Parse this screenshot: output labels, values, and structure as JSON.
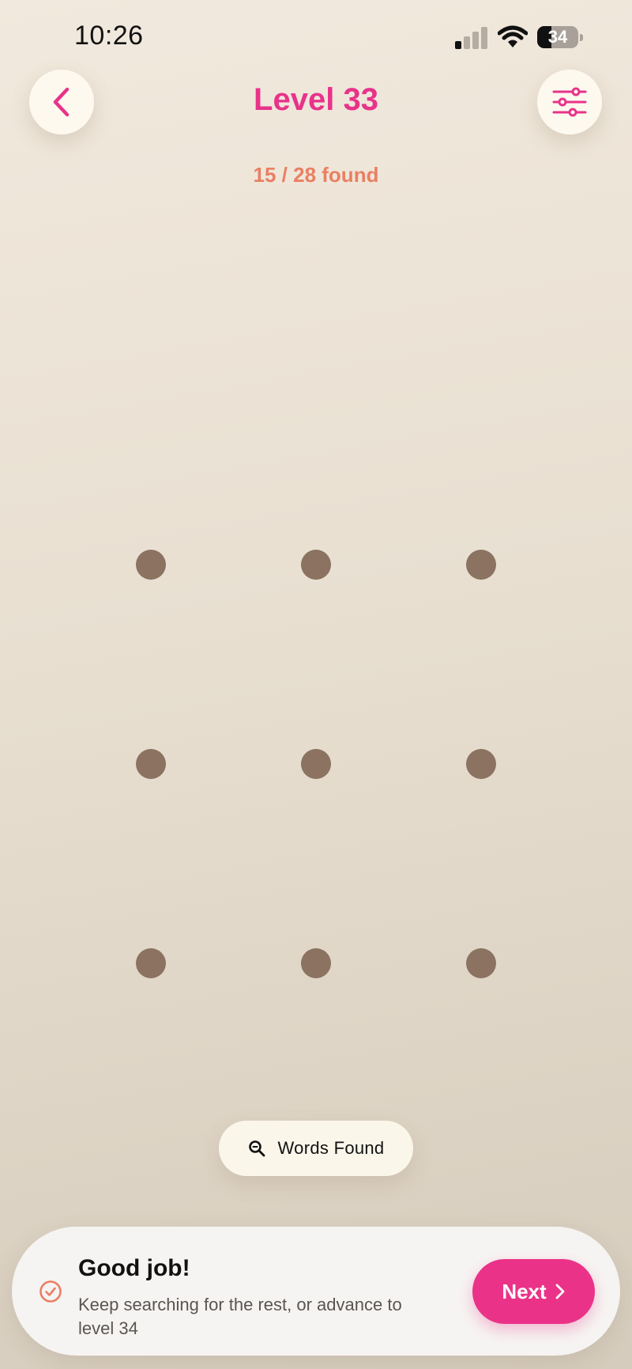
{
  "status_bar": {
    "time": "10:26",
    "battery_level": "34",
    "battery_fraction": 0.34
  },
  "header": {
    "title": "Level 33",
    "progress": "15 / 28 found"
  },
  "words_found_button": {
    "label": "Words Found"
  },
  "banner": {
    "title": "Good job!",
    "message": "Keep searching for the rest, or advance to level 34",
    "next_label": "Next"
  },
  "grid": {
    "rows": 3,
    "columns": 3
  },
  "colors": {
    "accent": "#e8338a",
    "progress": "#ea7f63",
    "dot": "#8b7261",
    "button_bg": "#fdf9ef"
  },
  "icons": {
    "back": "chevron-left-icon",
    "settings": "sliders-icon",
    "search": "search-icon",
    "check": "check-circle-icon",
    "next": "chevron-right-icon"
  }
}
